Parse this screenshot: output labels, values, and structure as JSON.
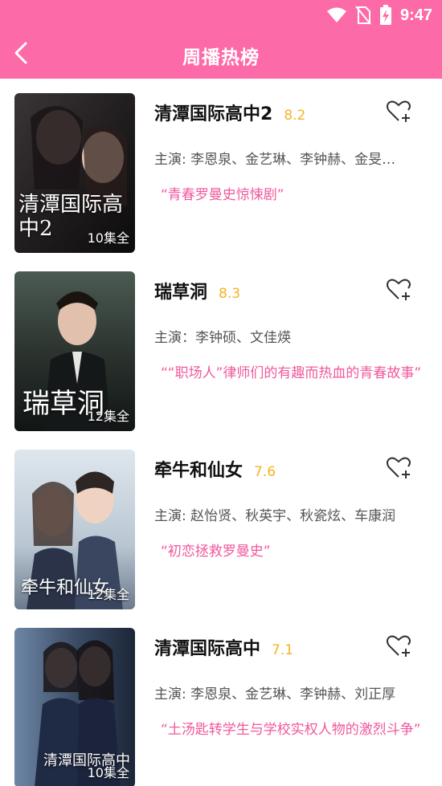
{
  "status": {
    "time": "9:47",
    "icons": [
      "wifi-icon",
      "no-sim-icon",
      "battery-charging-icon"
    ]
  },
  "header": {
    "title": "周播热榜",
    "back_icon": "chevron-left-icon",
    "bg_color": "#fd6aa8"
  },
  "colors": {
    "score": "#f5b324",
    "tagline": "#f0589c",
    "heart": "#333333"
  },
  "dramas": [
    {
      "name": "清潭国际高中2",
      "score": "8.2",
      "cast": "主演: 李恩泉、金艺琳、李钟赫、金旻…",
      "tagline": "“青春罗曼史惊悚剧”",
      "poster_title": "清潭国际高中2",
      "episodes": "10集全"
    },
    {
      "name": "瑞草洞",
      "score": "8.3",
      "cast": "主演：李钟硕、文佳煐",
      "tagline": "““职场人”律师们的有趣而热血的青春故事”",
      "poster_title": "瑞草洞",
      "episodes": "12集全"
    },
    {
      "name": "牵牛和仙女",
      "score": "7.6",
      "cast": "主演: 赵怡贤、秋英宇、秋瓷炫、车康润",
      "tagline": "“初恋拯救罗曼史”",
      "poster_title": "牵牛和仙女",
      "episodes": "12集全"
    },
    {
      "name": "清潭国际高中",
      "score": "7.1",
      "cast": "主演: 李恩泉、金艺琳、李钟赫、刘正厚",
      "tagline": "“土汤匙转学生与学校实权人物的激烈斗争”",
      "poster_title": "清潭国际高中",
      "episodes": "10集全"
    }
  ]
}
